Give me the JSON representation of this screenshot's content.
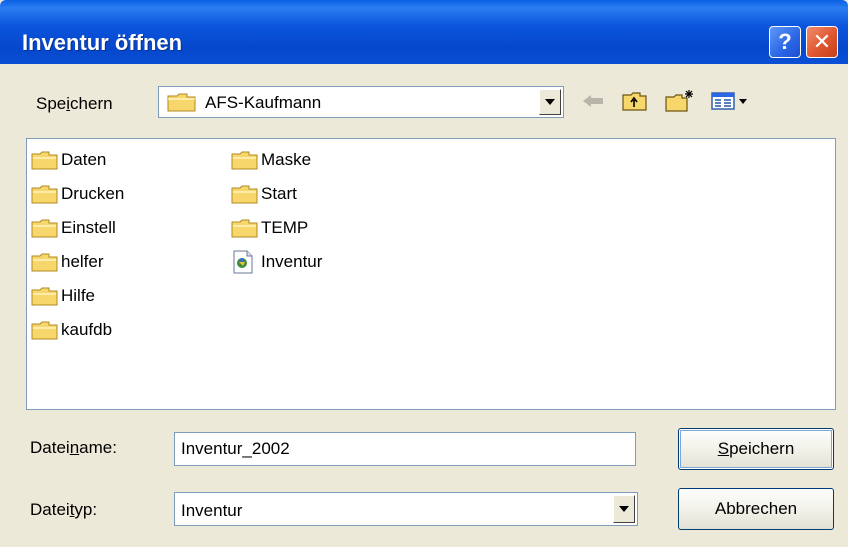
{
  "window": {
    "title": "Inventur öffnen",
    "help_label": "?",
    "close_label": "✕"
  },
  "lookin": {
    "label_pre": "Spe",
    "label_accel": "i",
    "label_post": "chern",
    "value": "AFS-Kaufmann"
  },
  "toolbar": {
    "back_icon": "back-arrow-icon",
    "up_icon": "folder-up-icon",
    "new_folder_icon": "new-folder-icon",
    "view_icon": "view-menu-icon"
  },
  "files": [
    {
      "name": "Daten",
      "type": "folder"
    },
    {
      "name": "Drucken",
      "type": "folder"
    },
    {
      "name": "Einstell",
      "type": "folder"
    },
    {
      "name": "helfer",
      "type": "folder"
    },
    {
      "name": "Hilfe",
      "type": "folder"
    },
    {
      "name": "kaufdb",
      "type": "folder"
    },
    {
      "name": "Maske",
      "type": "folder"
    },
    {
      "name": "Start",
      "type": "folder"
    },
    {
      "name": "TEMP",
      "type": "folder"
    },
    {
      "name": "Inventur",
      "type": "file"
    }
  ],
  "filename": {
    "label_pre": "Datei",
    "label_accel": "n",
    "label_post": "ame:",
    "value": "Inventur_2002"
  },
  "filetype": {
    "label_pre": "Datei",
    "label_accel": "t",
    "label_post": "yp:",
    "value": "Inventur"
  },
  "buttons": {
    "save_accel": "S",
    "save_rest": "peichern",
    "cancel": "Abbrechen"
  },
  "colors": {
    "titlebar": "#0b56dd",
    "dialog_bg": "#ece9d8",
    "folder_yellow": "#f7d66b",
    "close_red": "#e0562e"
  }
}
